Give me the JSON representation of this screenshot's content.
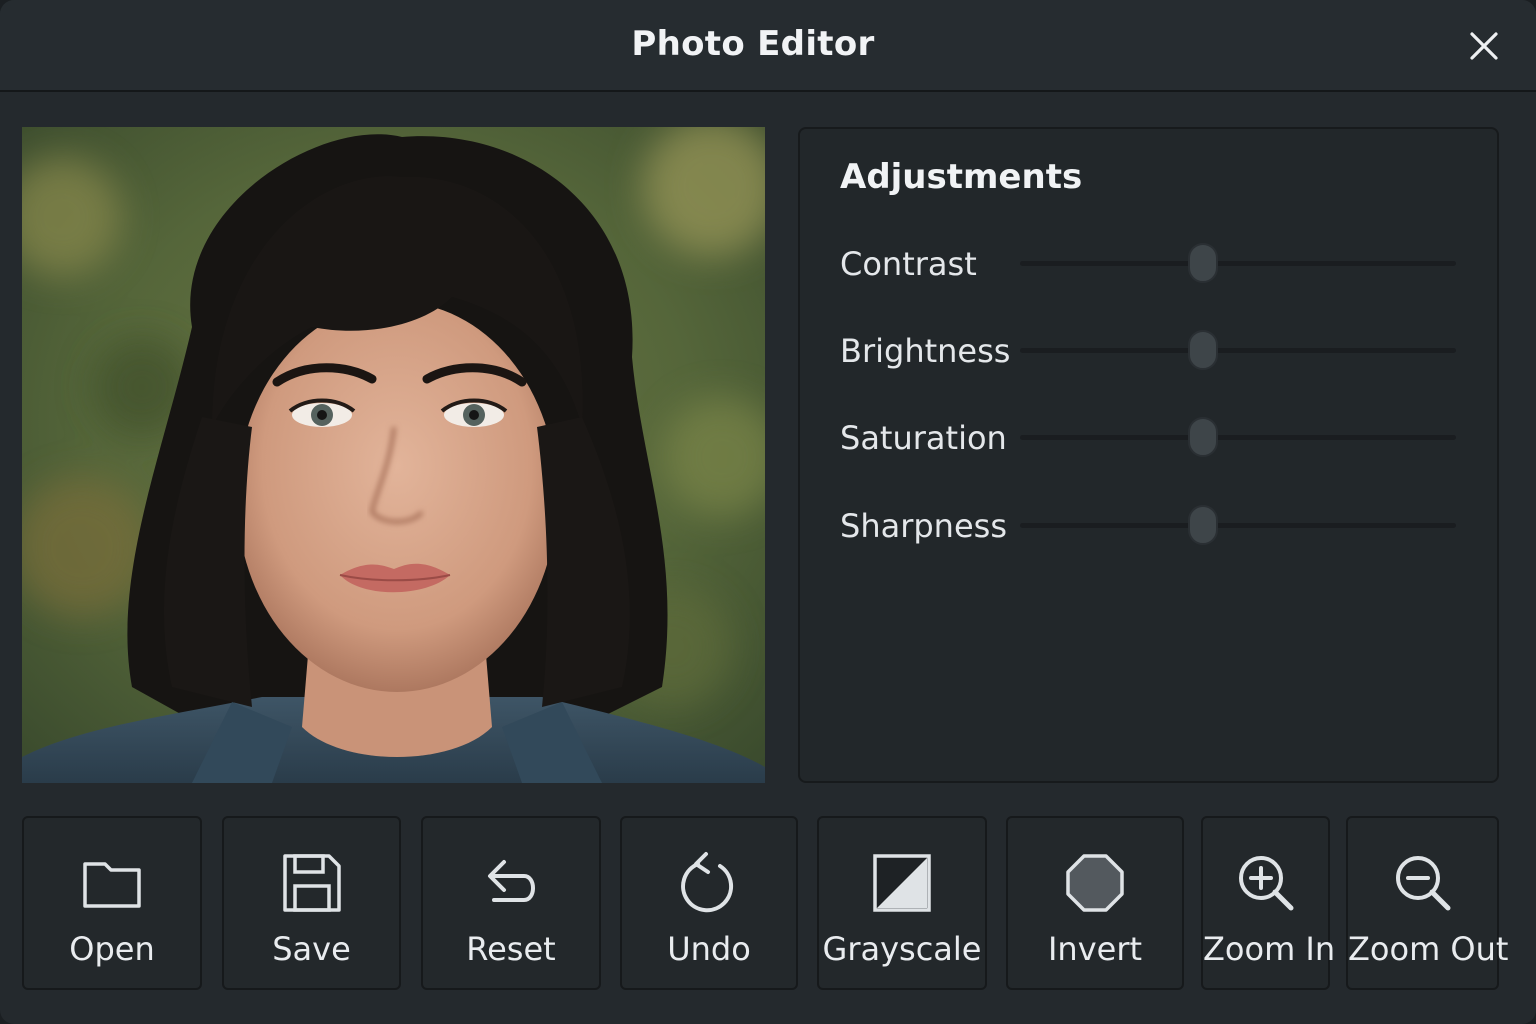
{
  "window": {
    "title": "Photo Editor"
  },
  "icons": {
    "close": "close-icon",
    "open": "folder-icon",
    "save": "floppy-disk-icon",
    "reset": "reset-arrow-icon",
    "undo": "undo-icon",
    "grayscale": "grayscale-icon",
    "invert": "octagon-icon",
    "zoom_in": "zoom-in-icon",
    "zoom_out": "zoom-out-icon"
  },
  "panel": {
    "title": "Adjustments",
    "adjustments": [
      {
        "label": "Contrast",
        "value": 0.42
      },
      {
        "label": "Brightness",
        "value": 0.42
      },
      {
        "label": "Saturation",
        "value": 0.42
      },
      {
        "label": "Sharpness",
        "value": 0.42
      }
    ]
  },
  "toolbar": {
    "open": "Open",
    "save": "Save",
    "reset": "Reset",
    "undo": "Undo",
    "grayscale": "Grayscale",
    "invert": "Invert",
    "zoom_in": "Zoom In",
    "zoom_out": "Zoom Out"
  },
  "colors": {
    "window_bg": "#24292d",
    "panel_bg": "#22272a",
    "text": "#e9ecef",
    "icon_stroke": "#dfe3e6"
  }
}
